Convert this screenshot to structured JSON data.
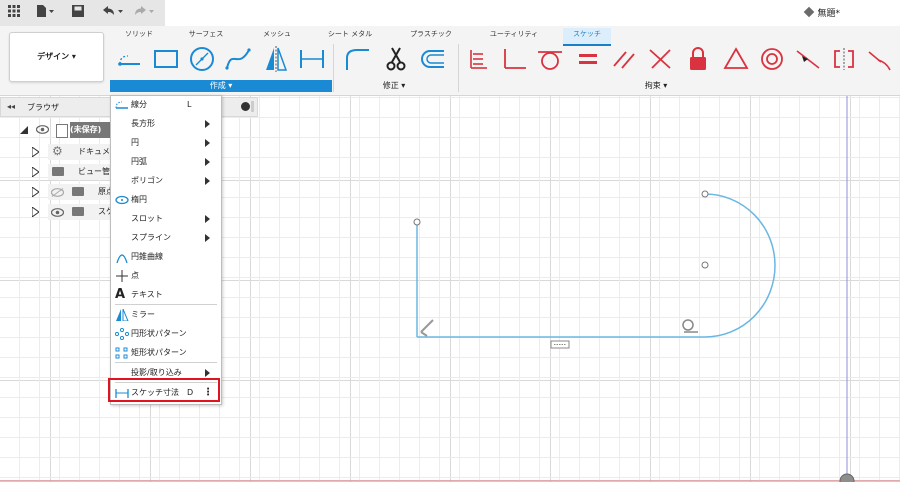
{
  "quick_access": {
    "icons": [
      "grid-icon",
      "file-icon",
      "save-icon",
      "undo-icon",
      "redo-icon"
    ]
  },
  "document": {
    "title": "無題*"
  },
  "ribbon": {
    "workspace": "デザイン ▾",
    "tabs": [
      {
        "label": "ソリッド"
      },
      {
        "label": "サーフェス"
      },
      {
        "label": "メッシュ"
      },
      {
        "label": "シート メタル"
      },
      {
        "label": "プラスチック"
      },
      {
        "label": "ユーティリティ"
      },
      {
        "label": "スケッチ"
      }
    ],
    "groups": {
      "create": "作成 ▾",
      "modify": "修正 ▾",
      "constraints": "拘束 ▾"
    }
  },
  "browser": {
    "title": "ブラウザ",
    "items": [
      {
        "label": "(未保存)"
      },
      {
        "label": "ドキュメン"
      },
      {
        "label": "ビュー管理"
      },
      {
        "label": "原点"
      },
      {
        "label": "スケ"
      }
    ]
  },
  "create_menu": {
    "items": [
      {
        "label": "線分",
        "shortcut": "L"
      },
      {
        "label": "長方形"
      },
      {
        "label": "円"
      },
      {
        "label": "円弧"
      },
      {
        "label": "ポリゴン"
      },
      {
        "label": "楕円"
      },
      {
        "label": "スロット"
      },
      {
        "label": "スプライン"
      },
      {
        "label": "円錐曲線"
      },
      {
        "label": "点"
      },
      {
        "label": "テキスト"
      },
      {
        "label": "ミラー"
      },
      {
        "label": "円形状パターン"
      },
      {
        "label": "矩形状パターン"
      },
      {
        "label": "投影/取り込み"
      },
      {
        "label": "スケッチ寸法",
        "shortcut": "D"
      }
    ]
  },
  "colors": {
    "accent": "#1a8ad4",
    "sketch_line": "#6bb7e3",
    "constraint": "#d9333f",
    "highlight": "#e0141e"
  }
}
